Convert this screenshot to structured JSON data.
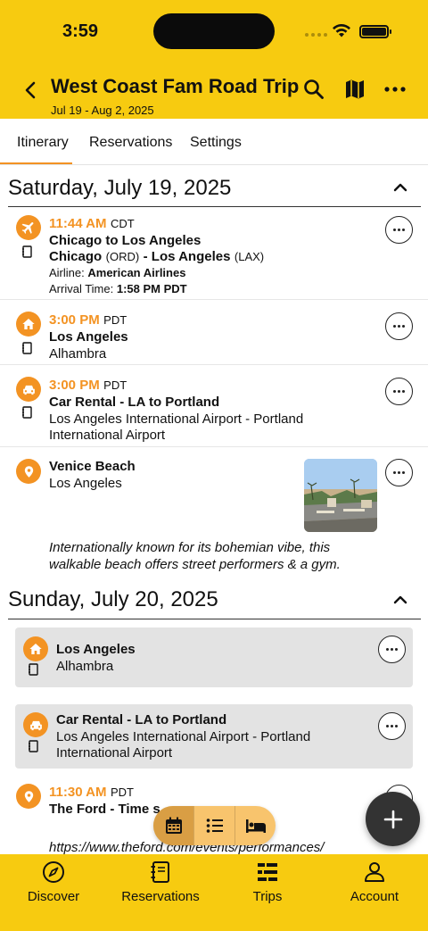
{
  "status_bar": {
    "time": "3:59"
  },
  "header": {
    "title": "West Coast Fam Road Trip",
    "dates": "Jul 19 - Aug 2, 2025"
  },
  "tabs": [
    {
      "label": "Itinerary",
      "active": true
    },
    {
      "label": "Reservations",
      "active": false
    },
    {
      "label": "Settings",
      "active": false
    }
  ],
  "accent_color": "#f39323",
  "brand_color": "#f7cb10",
  "days": [
    {
      "title": "Saturday, July 19, 2025",
      "items": [
        {
          "icon": "airplane-icon",
          "time": "11:44 AM",
          "tz": "CDT",
          "title": "Chicago to Los Angeles",
          "route_from": "Chicago",
          "route_from_code": "(ORD)",
          "route_sep": "- Los Angeles",
          "route_to_code": "(LAX)",
          "airline_label": "Airline:",
          "airline": "American Airlines",
          "arrival_label": "Arrival Time:",
          "arrival": "1:58 PM PDT"
        },
        {
          "icon": "home-icon",
          "time": "3:00 PM",
          "tz": "PDT",
          "title": "Los Angeles",
          "subtitle": "Alhambra"
        },
        {
          "icon": "car-icon",
          "time": "3:00 PM",
          "tz": "PDT",
          "title": "Car Rental - LA to Portland",
          "line1": "Los Angeles International Airport - Portland",
          "line2": "International Airport"
        },
        {
          "icon": "location-pin-icon",
          "title": "Venice Beach",
          "subtitle": "Los Angeles",
          "desc1": "Internationally known for its bohemian vibe, this",
          "desc2": "walkable beach offers street performers & a gym."
        }
      ]
    },
    {
      "title": "Sunday, July 20, 2025",
      "items": [
        {
          "icon": "home-icon",
          "title": "Los Angeles",
          "subtitle": "Alhambra"
        },
        {
          "icon": "car-icon",
          "title": "Car Rental - LA to Portland",
          "line1": "Los Angeles International Airport - Portland",
          "line2": "International Airport"
        },
        {
          "icon": "location-pin-icon",
          "time": "11:30 AM",
          "tz": "PDT",
          "title": "The Ford - Time s",
          "link": "https://www.theford.com/events/performances/"
        }
      ]
    }
  ],
  "view_switcher": [
    "calendar-icon",
    "list-icon",
    "bed-icon"
  ],
  "bottom_nav": [
    {
      "label": "Discover",
      "icon": "compass-icon"
    },
    {
      "label": "Reservations",
      "icon": "notebook-icon"
    },
    {
      "label": "Trips",
      "icon": "trips-list-icon"
    },
    {
      "label": "Account",
      "icon": "person-icon"
    }
  ]
}
